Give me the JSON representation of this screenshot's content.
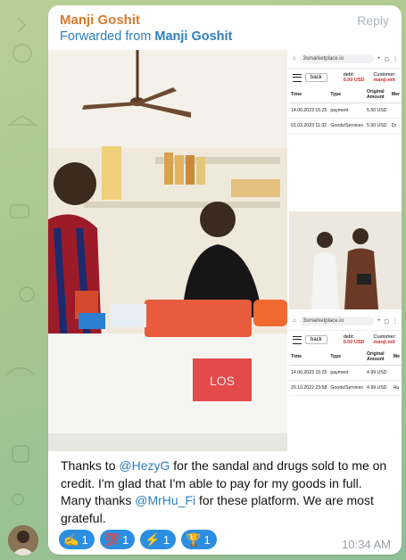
{
  "message": {
    "sender": "Manji Goshit",
    "reply_label": "Reply",
    "forwarded_prefix": "Forwarded from",
    "forwarded_from": "Manji Goshit",
    "text_parts": [
      {
        "t": "Thanks to ",
        "mention": false
      },
      {
        "t": "@HezyG",
        "mention": true
      },
      {
        "t": " for the sandal and drugs sold to me on credit. I'm glad that I'm able to pay for my goods in full. Many thanks ",
        "mention": false
      },
      {
        "t": "@MrHu_Fi",
        "mention": true
      },
      {
        "t": " for these platform. We are most grateful.",
        "mention": false
      }
    ],
    "time": "10:34 AM"
  },
  "reactions": [
    {
      "emoji": "✍️",
      "icon": "writing-hand-icon",
      "count": "1"
    },
    {
      "emoji": "💯",
      "icon": "hundred-points-icon",
      "count": "1"
    },
    {
      "emoji": "⚡",
      "icon": "lightning-icon",
      "count": "1"
    },
    {
      "emoji": "🏆",
      "icon": "trophy-icon",
      "count": "1"
    }
  ],
  "photo_sign": "LOS",
  "screenshot1": {
    "url": "3smarketplace.io",
    "back": "back",
    "debt_label": "debt:",
    "debt_value": "0.00 USD",
    "customer_label": "Customer:",
    "customer_value": "manji.mlt",
    "headers": [
      "Time",
      "Type",
      "Original Amount",
      "Mer"
    ],
    "rows": [
      [
        "14.06.2023 15:25",
        "payment",
        "5.50 USD",
        ""
      ],
      [
        "01.03.2023 11:32",
        "Goods/Services",
        "5.50 USD",
        "Dr"
      ]
    ]
  },
  "screenshot2": {
    "url": "3smarketplace.io",
    "back": "back",
    "debt_label": "debt:",
    "debt_value": "0.00 USD",
    "customer_label": "Customer:",
    "customer_value": "manji.mlt",
    "headers": [
      "Time",
      "Type",
      "Original Amount",
      "Me"
    ],
    "rows": [
      [
        "14.06.2023 15:25",
        "payment",
        "4.99 USD",
        ""
      ],
      [
        "29.10.2022 23:58",
        "Goods/Services",
        "4.99 USD",
        "Hu"
      ]
    ]
  }
}
